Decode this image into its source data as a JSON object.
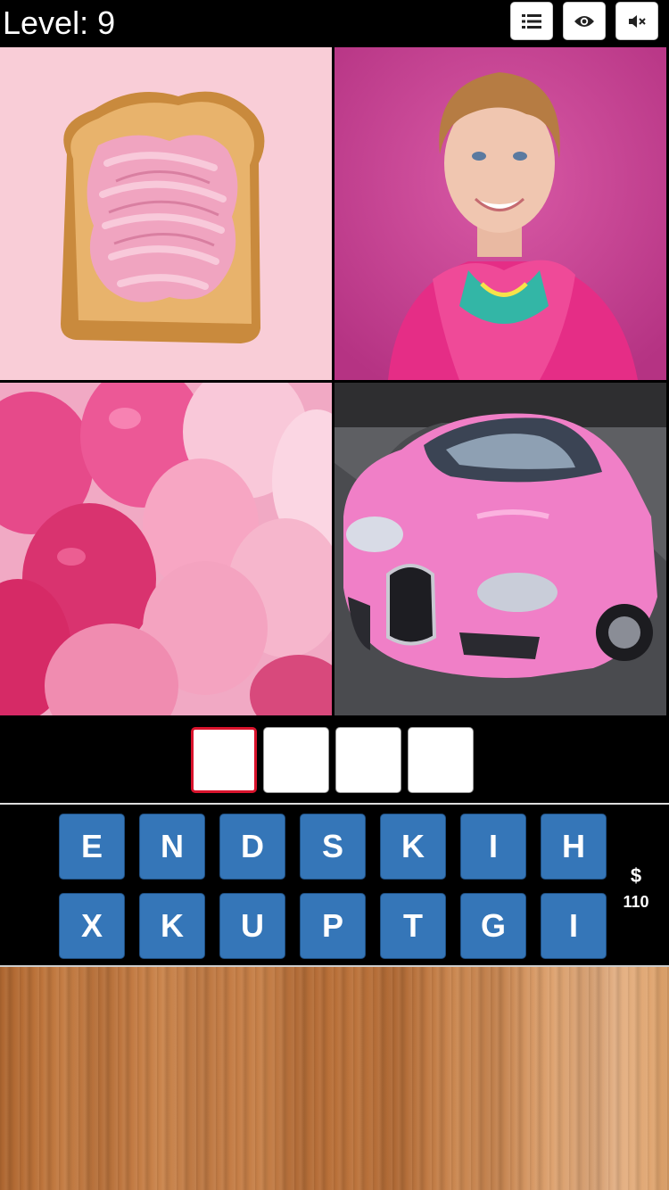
{
  "header": {
    "level_text": "Level: 9",
    "buttons": [
      {
        "icon": "list-icon"
      },
      {
        "icon": "eye-icon"
      },
      {
        "icon": "mute-icon"
      }
    ]
  },
  "images": [
    {
      "subject": "toast-with-pink-frosting"
    },
    {
      "subject": "woman-in-pink"
    },
    {
      "subject": "pink-balloons"
    },
    {
      "subject": "pink-sports-car"
    }
  ],
  "answer": {
    "slots": [
      "",
      "",
      "",
      ""
    ],
    "active_index": 0
  },
  "letters": {
    "row1": [
      "E",
      "N",
      "D",
      "S",
      "K",
      "I",
      "H"
    ],
    "row2": [
      "X",
      "K",
      "U",
      "P",
      "T",
      "G",
      "I"
    ]
  },
  "coins": {
    "symbol": "$",
    "amount": "110"
  },
  "colors": {
    "key_blue": "#3576b8",
    "active_slot_border": "#d9132c",
    "background": "#000000"
  }
}
